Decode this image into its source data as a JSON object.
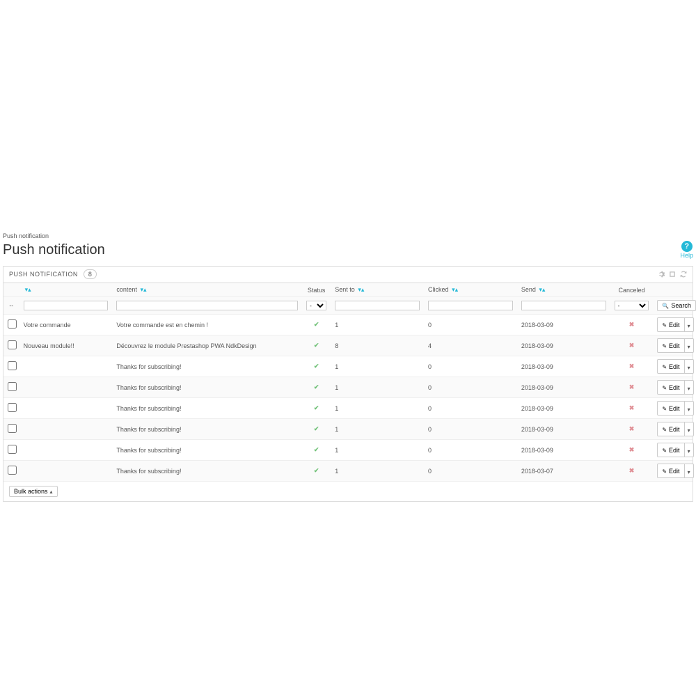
{
  "breadcrumb": "Push notification",
  "page_title": "Push notification",
  "help": {
    "label": "Help"
  },
  "panel": {
    "title": "PUSH NOTIFICATION",
    "count": "8"
  },
  "columns": {
    "title": "",
    "content": "content",
    "status": "Status",
    "sentto": "Sent to",
    "clicked": "Clicked",
    "send": "Send",
    "canceled": "Canceled"
  },
  "filters": {
    "title_sort": "--",
    "status_placeholder": "-",
    "canceled_placeholder": "-",
    "search_label": "Search"
  },
  "bulk_label": "Bulk actions",
  "edit_label": "Edit",
  "rows": [
    {
      "title": "Votre commande",
      "content": "Votre commande est en chemin !",
      "status": true,
      "sentto": "1",
      "clicked": "0",
      "send": "2018-03-09",
      "canceled": false
    },
    {
      "title": "Nouveau module!!",
      "content": "Découvrez le module Prestashop PWA NdkDesign",
      "status": true,
      "sentto": "8",
      "clicked": "4",
      "send": "2018-03-09",
      "canceled": false
    },
    {
      "title": "",
      "content": "Thanks for subscribing!",
      "status": true,
      "sentto": "1",
      "clicked": "0",
      "send": "2018-03-09",
      "canceled": false
    },
    {
      "title": "",
      "content": "Thanks for subscribing!",
      "status": true,
      "sentto": "1",
      "clicked": "0",
      "send": "2018-03-09",
      "canceled": false
    },
    {
      "title": "",
      "content": "Thanks for subscribing!",
      "status": true,
      "sentto": "1",
      "clicked": "0",
      "send": "2018-03-09",
      "canceled": false
    },
    {
      "title": "",
      "content": "Thanks for subscribing!",
      "status": true,
      "sentto": "1",
      "clicked": "0",
      "send": "2018-03-09",
      "canceled": false
    },
    {
      "title": "",
      "content": "Thanks for subscribing!",
      "status": true,
      "sentto": "1",
      "clicked": "0",
      "send": "2018-03-09",
      "canceled": false
    },
    {
      "title": "",
      "content": "Thanks for subscribing!",
      "status": true,
      "sentto": "1",
      "clicked": "0",
      "send": "2018-03-07",
      "canceled": false
    }
  ]
}
